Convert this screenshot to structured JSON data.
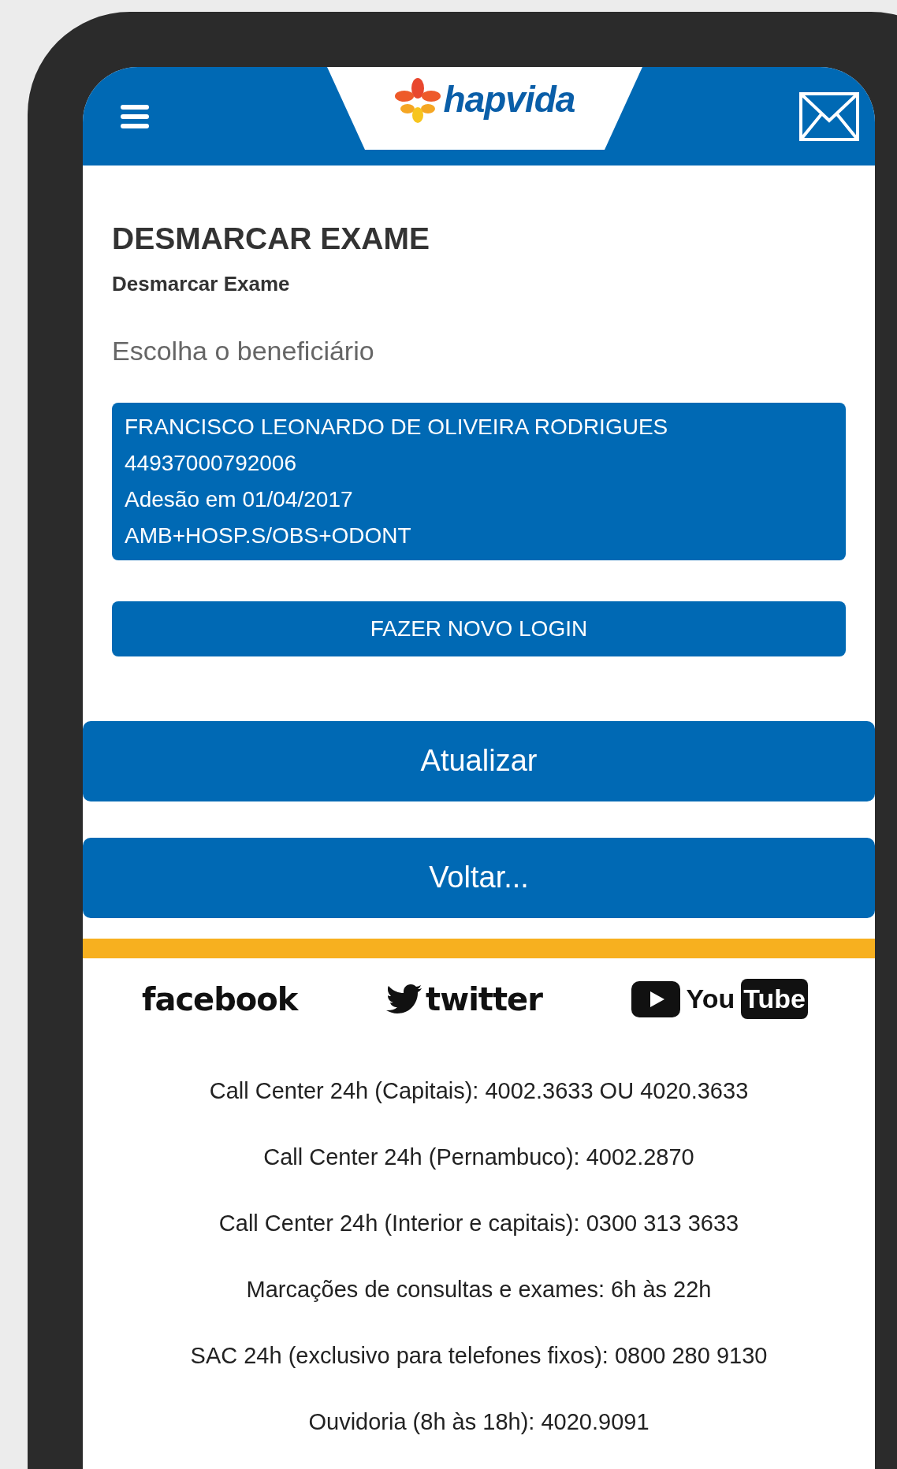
{
  "header": {
    "logo_text": "hapvida"
  },
  "page": {
    "title": "DESMARCAR EXAME",
    "subtitle": "Desmarcar Exame",
    "prompt": "Escolha o beneficiário"
  },
  "beneficiary": {
    "selected": true,
    "lines": [
      "FRANCISCO LEONARDO DE OLIVEIRA RODRIGUES",
      "44937000792006",
      "Adesão em 01/04/2017",
      "AMB+HOSP.S/OBS+ODONT"
    ]
  },
  "login_button": "FAZER NOVO LOGIN",
  "actions": [
    "Atualizar",
    "Voltar..."
  ],
  "social": {
    "facebook": "facebook",
    "twitter": "twitter",
    "youtube_you": "You",
    "youtube_tube": "Tube"
  },
  "contacts": [
    "Call Center 24h (Capitais): 4002.3633 OU 4020.3633",
    "Call Center 24h (Pernambuco): 4002.2870",
    "Call Center 24h (Interior e capitais): 0300 313 3633",
    "Marcações de consultas e exames: 6h às 22h",
    "SAC 24h (exclusivo para telefones fixos): 0800 280 9130",
    "Ouvidoria (8h às 18h): 4020.9091"
  ]
}
